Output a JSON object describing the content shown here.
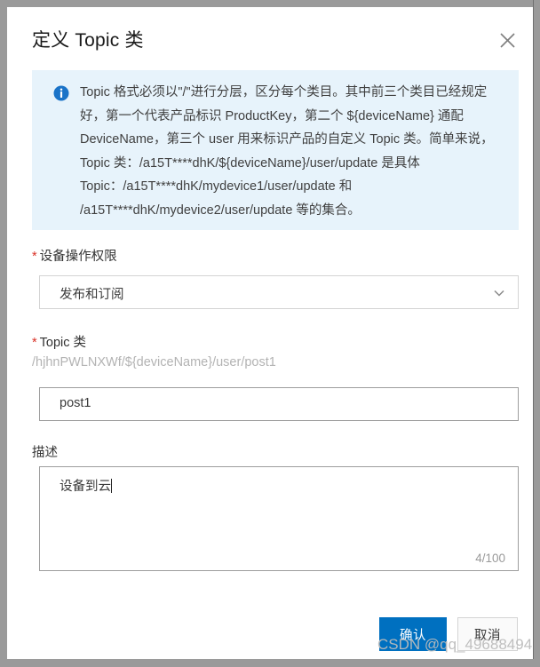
{
  "dialog": {
    "title": "定义 Topic 类",
    "close_icon": "close-icon"
  },
  "info_banner": {
    "icon": "info-circle-icon",
    "text": "Topic 格式必须以\"/\"进行分层，区分每个类目。其中前三个类目已经规定好，第一个代表产品标识 ProductKey，第二个 ${deviceName} 通配 DeviceName，第三个 user 用来标识产品的自定义 Topic 类。简单来说，Topic 类：/a15T****dhK/${deviceName}/user/update 是具体 Topic：/a15T****dhK/mydevice1/user/update 和 /a15T****dhK/mydevice2/user/update 等的集合。"
  },
  "fields": {
    "permission": {
      "label": "设备操作权限",
      "required": true,
      "required_marker": "*",
      "value": "发布和订阅",
      "chevron_icon": "chevron-down-icon"
    },
    "topic": {
      "label": "Topic 类",
      "required": true,
      "required_marker": "*",
      "prefix": "/hjhnPWLNXWf/${deviceName}/user/post1",
      "value": "post1",
      "placeholder": ""
    },
    "description": {
      "label": "描述",
      "required": false,
      "value": "设备到云",
      "placeholder": "",
      "char_count": "4/100"
    }
  },
  "footer": {
    "confirm_label": "确认",
    "cancel_label": "取消"
  },
  "watermark": {
    "text": "CSDN @qq_49688494"
  },
  "colors": {
    "primary": "#0070c0",
    "info_bg": "#e7f3fb",
    "required_star": "#d93026",
    "overlay": "#9a9a9a"
  }
}
